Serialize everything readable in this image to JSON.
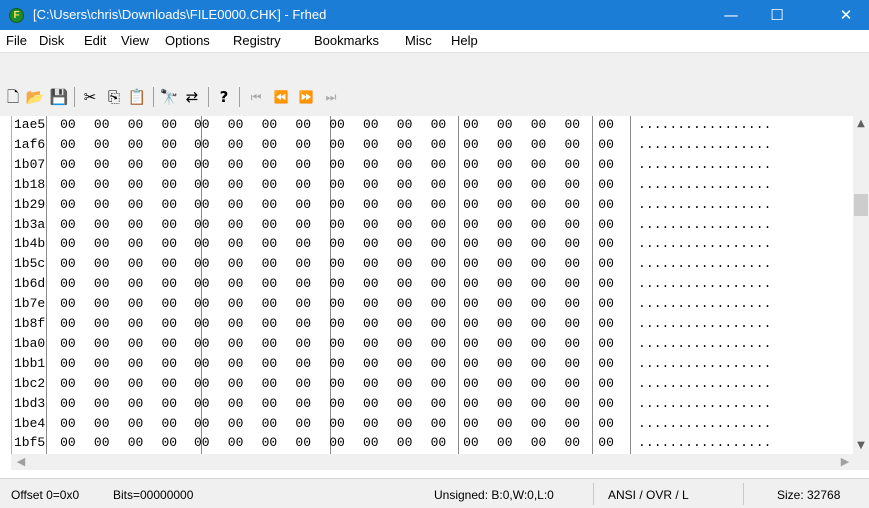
{
  "window": {
    "title": "[C:\\Users\\chris\\Downloads\\FILE0000.CHK] - Frhed",
    "app_icon_letter": "F",
    "minimize": "—",
    "maximize": "☐",
    "close": "✕"
  },
  "menu": [
    "File",
    "Disk",
    "Edit",
    "View",
    "Options",
    "Registry",
    "Bookmarks",
    "Misc",
    "Help"
  ],
  "toolbar": {
    "new_glyph": "🗋",
    "open_glyph": "📂",
    "save_glyph": "💾",
    "cut_glyph": "✂",
    "copy_glyph": "⎘",
    "paste_glyph": "📋",
    "find_glyph": "🔭",
    "replace_glyph": "⇄",
    "help_glyph": "?",
    "first_glyph": "⏮",
    "prev_glyph": "⏪",
    "next_glyph": "⏩",
    "last_glyph": "⏭"
  },
  "hex": {
    "offsets": [
      "1ae5",
      "1af6",
      "1b07",
      "1b18",
      "1b29",
      "1b3a",
      "1b4b",
      "1b5c",
      "1b6d",
      "1b7e",
      "1b8f",
      "1ba0",
      "1bb1",
      "1bc2",
      "1bd3",
      "1be4",
      "1bf5"
    ],
    "byte_value": "00",
    "bytes_per_row": 17,
    "ascii_text": "................."
  },
  "scroll": {
    "up": "▲",
    "down": "▼",
    "left": "◀",
    "right": "▶"
  },
  "status": {
    "offset": "Offset 0=0x0",
    "bits": "Bits=00000000",
    "unsigned": "Unsigned: B:0,W:0,L:0",
    "mode": "ANSI / OVR / L",
    "size": "Size: 32768"
  }
}
